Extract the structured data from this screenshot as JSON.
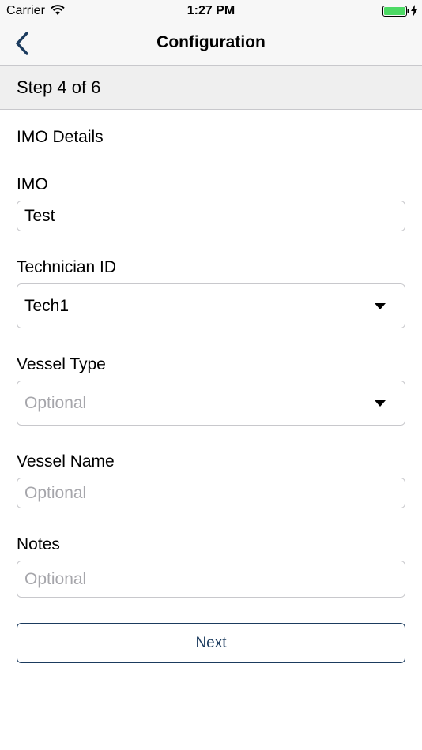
{
  "status_bar": {
    "carrier": "Carrier",
    "time": "1:27 PM",
    "battery_color": "#4cd964"
  },
  "nav": {
    "title": "Configuration",
    "back_icon": "chevron-left-icon",
    "accent_color": "#1b3b5e"
  },
  "step": {
    "text": "Step 4 of 6"
  },
  "form": {
    "section_title": "IMO Details",
    "imo": {
      "label": "IMO",
      "value": "Test"
    },
    "technician_id": {
      "label": "Technician ID",
      "value": "Tech1"
    },
    "vessel_type": {
      "label": "Vessel Type",
      "placeholder": "Optional"
    },
    "vessel_name": {
      "label": "Vessel Name",
      "placeholder": "Optional"
    },
    "notes": {
      "label": "Notes",
      "placeholder": "Optional"
    }
  },
  "actions": {
    "next_label": "Next"
  }
}
